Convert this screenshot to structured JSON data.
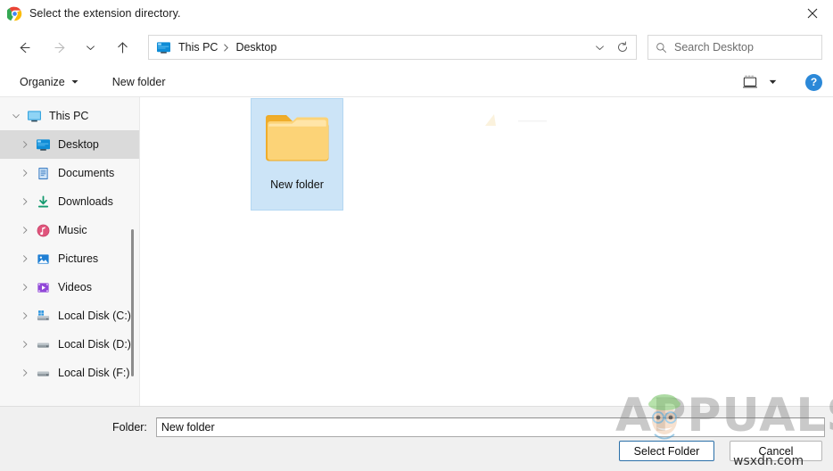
{
  "window": {
    "title": "Select the extension directory.",
    "app_icon": "chrome-icon",
    "close_label": "✕"
  },
  "nav": {
    "back": "back-arrow-icon",
    "forward": "forward-arrow-icon",
    "recent": "recent-locations-chevron-icon",
    "up": "up-arrow-icon"
  },
  "address": {
    "icon": "desktop-monitor-icon",
    "crumbs": [
      "This PC",
      "Desktop"
    ],
    "separator": "›",
    "dropdown": "chevron-down-icon",
    "refresh": "refresh-icon"
  },
  "search": {
    "icon": "search-icon",
    "placeholder": "Search Desktop",
    "value": ""
  },
  "toolbar": {
    "organize_label": "Organize",
    "new_folder_label": "New folder",
    "view_icon": "view-layout-icon",
    "view_caret": "chevron-down-icon",
    "help_label": "?"
  },
  "sidebar": {
    "items": [
      {
        "label": "This PC",
        "icon": "monitor-icon",
        "level": 1,
        "expanded": true,
        "selected": false
      },
      {
        "label": "Desktop",
        "icon": "desktop-icon",
        "level": 2,
        "expanded": false,
        "selected": true
      },
      {
        "label": "Documents",
        "icon": "documents-icon",
        "level": 2,
        "expanded": false,
        "selected": false
      },
      {
        "label": "Downloads",
        "icon": "downloads-icon",
        "level": 2,
        "expanded": false,
        "selected": false
      },
      {
        "label": "Music",
        "icon": "music-icon",
        "level": 2,
        "expanded": false,
        "selected": false
      },
      {
        "label": "Pictures",
        "icon": "pictures-icon",
        "level": 2,
        "expanded": false,
        "selected": false
      },
      {
        "label": "Videos",
        "icon": "videos-icon",
        "level": 2,
        "expanded": false,
        "selected": false
      },
      {
        "label": "Local Disk (C:)",
        "icon": "system-drive-icon",
        "level": 2,
        "expanded": false,
        "selected": false
      },
      {
        "label": "Local Disk (D:)",
        "icon": "drive-icon",
        "level": 2,
        "expanded": false,
        "selected": false
      },
      {
        "label": "Local Disk (F:)",
        "icon": "drive-icon",
        "level": 2,
        "expanded": false,
        "selected": false
      }
    ]
  },
  "content": {
    "files": [
      {
        "name": "New folder",
        "icon": "folder-icon",
        "selected": true
      }
    ]
  },
  "footer": {
    "folder_label": "Folder:",
    "folder_value": "New folder",
    "select_button": "Select Folder",
    "cancel_button": "Cancel"
  },
  "watermarks": {
    "brand": "APPUALS",
    "site": "wsxdn.com"
  },
  "colors": {
    "selection_blue": "#cce4f7",
    "sidebar_bg": "#f7f7f7",
    "footer_bg": "#f0f0f0",
    "accent_blue": "#2b88d8",
    "primary_border": "#2a6fa8",
    "folder_yellow": "#fdd168"
  }
}
